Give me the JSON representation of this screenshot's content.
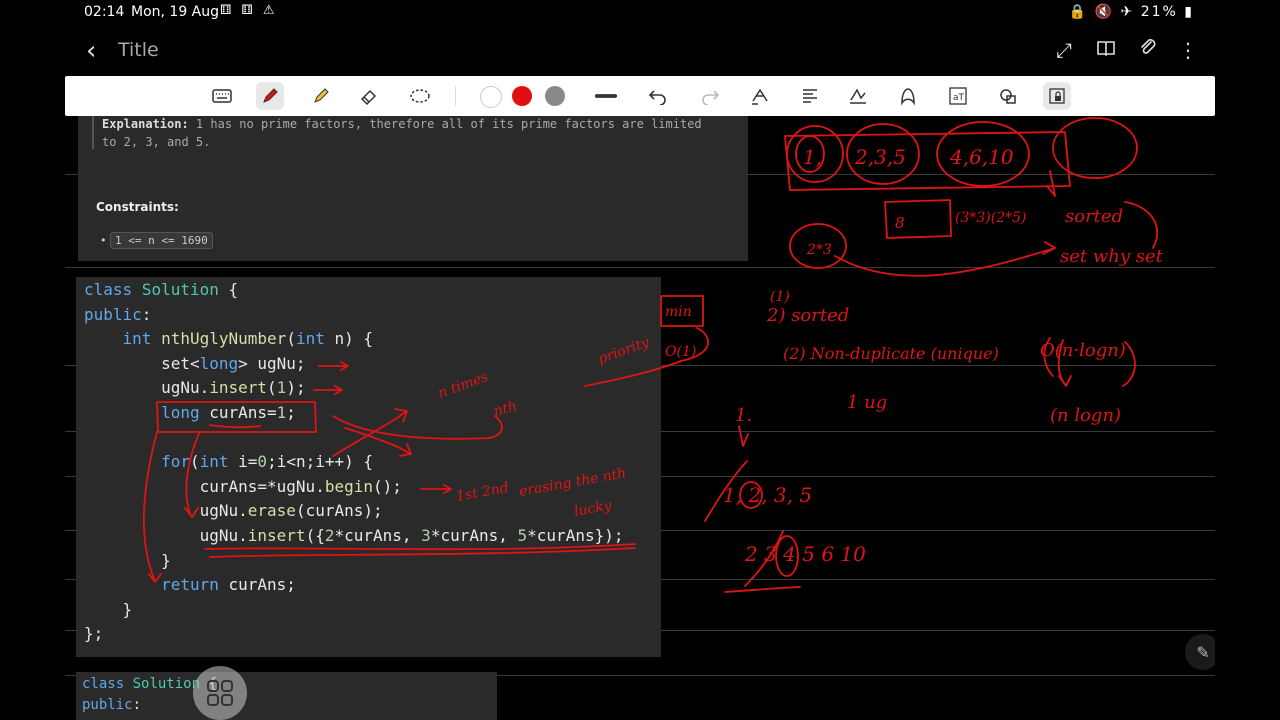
{
  "status": {
    "time": "02:14",
    "date": "Mon, 19 Aug",
    "notif_icons": "⚅ ⚅ ⚠",
    "battery": "21%",
    "right_icons": "🔒 🔇 ✈"
  },
  "header": {
    "title": "Title",
    "back_glyph": "‹",
    "icons": [
      "expand-icon",
      "book-icon",
      "attach-icon",
      "more-icon"
    ]
  },
  "toolbar": {
    "tools": [
      "keyboard-icon",
      "pen-icon",
      "highlighter-icon",
      "eraser-icon",
      "lasso-icon"
    ],
    "colors": [
      "#ffffff",
      "#e01010",
      "#888888"
    ],
    "actions": [
      "stroke-icon",
      "undo-icon",
      "redo-icon",
      "lasso-pen-icon",
      "text-format-icon",
      "handwriting-icon",
      "shape-icon",
      "ocr-icon",
      "shapes-icon",
      "lock-icon"
    ]
  },
  "problem": {
    "explanation_label": "Explanation:",
    "explanation_text": " 1 has no prime factors, therefore all of its prime factors are limited\nto 2, 3, and 5.",
    "constraints_label": "Constraints:",
    "constraint": "1 <= n <= 1690"
  },
  "code": {
    "lines": [
      [
        "class",
        " ",
        "Solution",
        " {"
      ],
      [
        "public",
        ":"
      ],
      [
        "    ",
        "int",
        " ",
        "nthUglyNumber",
        "(",
        "int",
        " n) {"
      ],
      [
        "        set<",
        "long",
        "> ugNu;"
      ],
      [
        "        ugNu.",
        "insert",
        "(",
        "1",
        ");"
      ],
      [
        "        ",
        "long",
        " curAns=",
        "1",
        ";"
      ],
      [
        ""
      ],
      [
        "        ",
        "for",
        "(",
        "int",
        " i=",
        "0",
        ";i<n;i++) {"
      ],
      [
        "            curAns=*ugNu.",
        "begin",
        "();"
      ],
      [
        "            ugNu.",
        "erase",
        "(curAns);"
      ],
      [
        "            ugNu.",
        "insert",
        "({",
        "2",
        "*curAns, ",
        "3",
        "*curAns, ",
        "5",
        "*curAns});"
      ],
      [
        "        }"
      ],
      [
        "        ",
        "return",
        " curAns;"
      ],
      [
        "    }"
      ],
      [
        "};"
      ]
    ],
    "second_panel_line1": [
      "class",
      " ",
      "Solution",
      " {"
    ],
    "second_panel_line2": [
      "public",
      ":"
    ]
  },
  "ink_color": "#e01414"
}
